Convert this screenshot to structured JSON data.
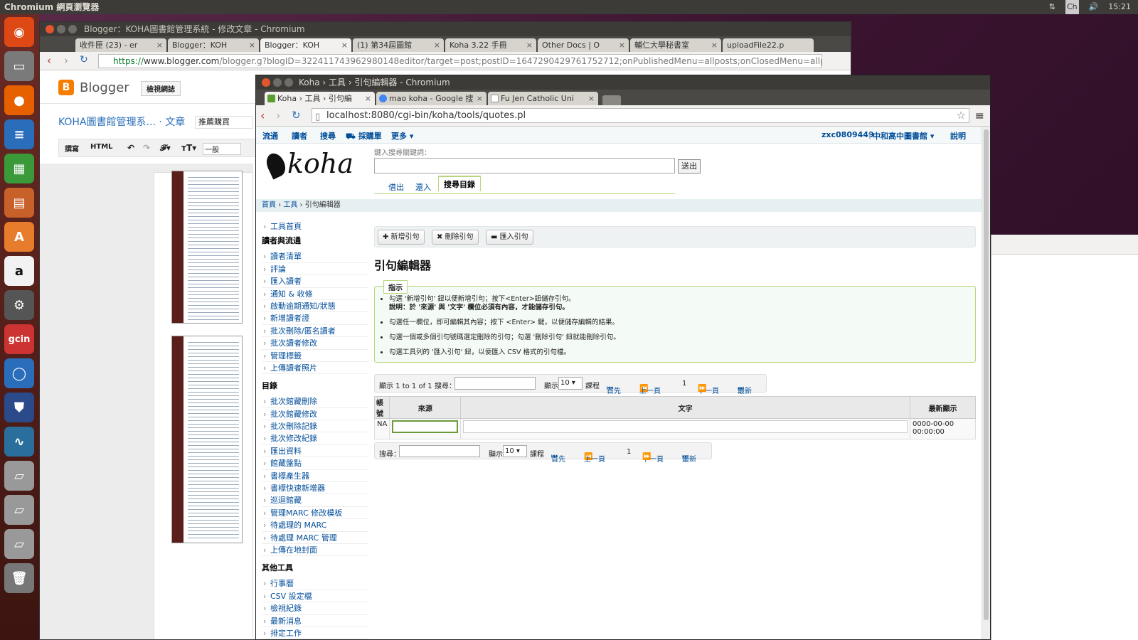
{
  "desktop": {
    "app_title": "Chromium 網頁瀏覽器",
    "tray": {
      "arrows": "⇅",
      "input": "Ch",
      "volume": "🔊",
      "time": "15:21"
    }
  },
  "launcher": {
    "items": [
      "ubuntu",
      "files",
      "firefox",
      "writer",
      "calc",
      "impress",
      "software",
      "amazon",
      "settings",
      "gcin",
      "chromium",
      "shield",
      "monitor",
      "drive1",
      "drive2",
      "drive3",
      "trash"
    ],
    "labels": {
      "ubuntu": "◉",
      "files": "▭",
      "firefox": "●",
      "writer": "≡",
      "calc": "▦",
      "impress": "▤",
      "software": "A",
      "amazon": "a",
      "settings": "⚙",
      "gcin": "gcin",
      "chromium": "◯",
      "shield": "⛊",
      "monitor": "∿",
      "drive1": "▱",
      "drive2": "▱",
      "drive3": "▱",
      "trash": "🗑"
    }
  },
  "back_window": {
    "title": "Blogger：KOHA圖書館管理系統 - 修改文章 - Chromium",
    "tabs": [
      "收件匣 (23) - er",
      "Blogger：KOH",
      "Blogger：KOH",
      "(1) 第34屆圖館",
      "Koha 3.22 手冊",
      "Other Docs | O",
      "輔仁大學秘書室",
      "uploadFile22.p"
    ],
    "url_prefix": "https://",
    "url_host": "www.blogger.com",
    "url_rest": "/blogger.g?blogID=322411743962980148editor/target=post;postID=1647290429761752712;onPublishedMenu=allposts;onClosedMenu=allpo",
    "blogger": {
      "logo": "B",
      "name": "Blogger",
      "view_button": "檢視網誌",
      "post_title": "KOHA圖書館管理系... · 文章",
      "post_field": "推薦購買",
      "compose": "撰寫",
      "html": "HTML",
      "font_normal": "一般"
    }
  },
  "front_window": {
    "title": "Koha › 工具 › 引句編輯器 - Chromium",
    "tabs": [
      {
        "label": "Koha › 工具 › 引句編",
        "icon": "koha-icon",
        "color": "#5a9e2f"
      },
      {
        "label": "mao koha - Google 搜",
        "icon": "google-icon",
        "color": "#4285f4"
      },
      {
        "label": "Fu Jen Catholic Uni",
        "icon": "page-icon",
        "color": "#aaaaaa"
      }
    ],
    "url": "localhost:8080/cgi-bin/koha/tools/quotes.pl"
  },
  "koha": {
    "nav": {
      "circulation": "流通",
      "patrons": "讀者",
      "search": "搜尋",
      "cart": "採購單",
      "more": "更多 ▾",
      "user": "zxc0809449",
      "branch": "中和高中圖書館 ▾",
      "help": "說明"
    },
    "logo": "koha",
    "search_label": "鍵入搜尋關鍵詞：",
    "go": "送出",
    "search_tabs": {
      "checkout": "借出",
      "checkin": "還入",
      "catalog": "搜尋目錄"
    },
    "breadcrumb": {
      "home": "首頁",
      "sep": " › ",
      "tools": "工具",
      "current": "引句編輯器"
    },
    "sidebar": {
      "tools_home": "工具首頁",
      "section1": "讀者與流通",
      "patrons_circ": [
        "讀者清單",
        "評論",
        "匯入讀者",
        "通知 & 收條",
        "啟動逾期通知/狀態",
        "新增讀者證",
        "批次刪除/匿名讀者",
        "批次讀者修改",
        "管理標籤",
        "上傳讀者照片"
      ],
      "section2": "目錄",
      "catalog": [
        "批次館藏刪除",
        "批次館藏修改",
        "批次刪除記錄",
        "批次修改紀錄",
        "匯出資料",
        "館藏盤點",
        "書標產生器",
        "書標快速新增器",
        "巡迴館藏",
        "管理MARC 修改模板",
        "待處理的 MARC",
        "待處理 MARC 管理",
        "上傳在地封面"
      ],
      "section3": "其他工具",
      "other": [
        "行事曆",
        "CSV 設定檔",
        "檢視紀錄",
        "最新消息",
        "排定工作"
      ]
    },
    "toolbar": {
      "add": "✚ 新增引句",
      "delete": "✖ 刪除引句",
      "import": "▬ 匯入引句"
    },
    "heading": "引句編輯器",
    "hint": {
      "legend": "指示",
      "items": [
        "勾選 '新增引句' 鈕以便新增引句；按下<Enter>鈕儲存引句。",
        "說明：於 '來源' 與 '文字' 欄位必須有內容，才能儲存引句。",
        "勾選任一欄位，即可編輯其內容；按下 <Enter> 鍵，以便儲存編輯的結果。",
        "勾選一個或多個引句號碼選定刪除的引句；勾選 '刪除引句' 鈕就能刪除引句。",
        "勾選工具列的 '匯入引句' 鈕，以便匯入 CSV 格式的引句檔。"
      ]
    },
    "pager": {
      "info": "顯示 1 to 1 of 1",
      "search": "搜尋：",
      "show": "顯示",
      "per_page": "10 ▾",
      "unit": "課程",
      "first": "首先",
      "prev": "上一頁",
      "page": "1",
      "next": "下一頁",
      "last": "最新"
    },
    "table": {
      "headers": [
        "帳號",
        "來源",
        "文字",
        "最新顯示"
      ],
      "rows": [
        {
          "id": "NA",
          "source": "",
          "text": "",
          "last_shown": "0000-00-00 00:00:00"
        }
      ]
    }
  }
}
